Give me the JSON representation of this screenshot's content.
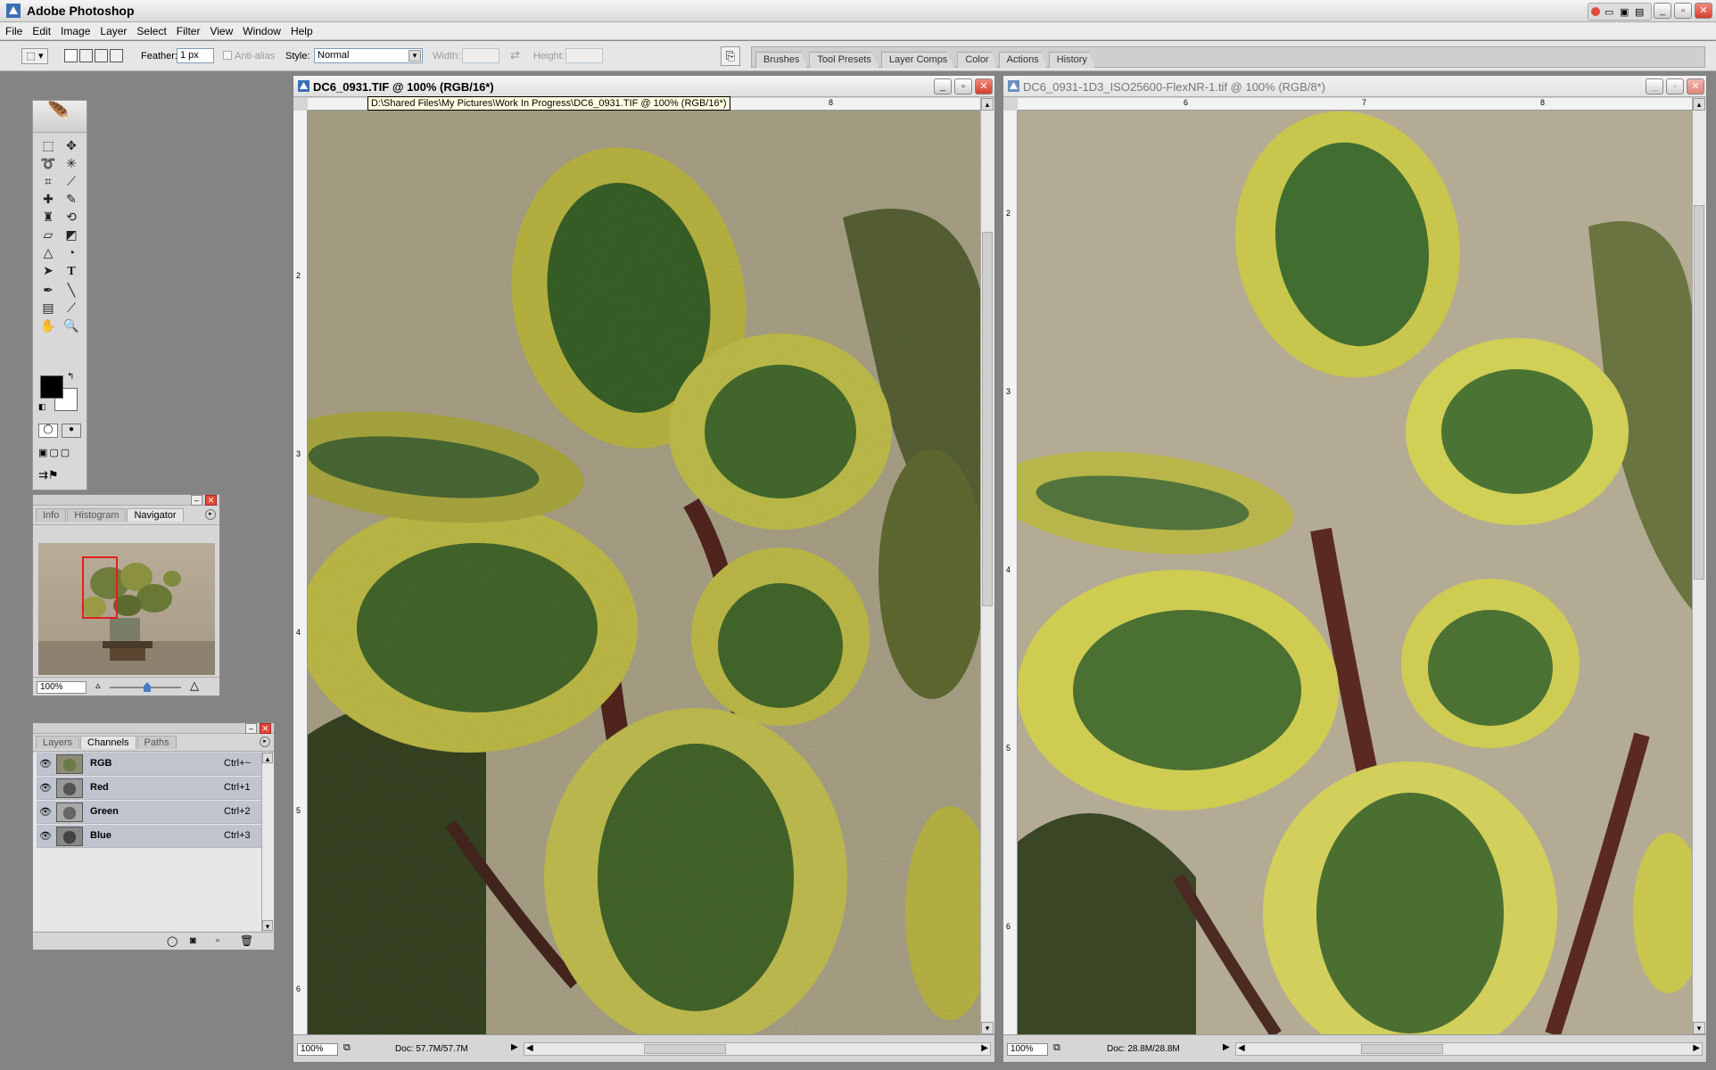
{
  "app": {
    "title": "Adobe Photoshop"
  },
  "menu": [
    "File",
    "Edit",
    "Image",
    "Layer",
    "Select",
    "Filter",
    "View",
    "Window",
    "Help"
  ],
  "options": {
    "feather_label": "Feather:",
    "feather_value": "1 px",
    "antialias_label": "Anti-alias",
    "style_label": "Style:",
    "style_value": "Normal",
    "width_label": "Width:",
    "height_label": "Height:"
  },
  "palette_well": [
    "Brushes",
    "Tool Presets",
    "Layer Comps",
    "Color",
    "Actions",
    "History"
  ],
  "navigator": {
    "tabs": [
      "Info",
      "Histogram",
      "Navigator"
    ],
    "zoom": "100%"
  },
  "channels": {
    "tabs": [
      "Layers",
      "Channels",
      "Paths"
    ],
    "rows": [
      {
        "name": "RGB",
        "key": "Ctrl+~"
      },
      {
        "name": "Red",
        "key": "Ctrl+1"
      },
      {
        "name": "Green",
        "key": "Ctrl+2"
      },
      {
        "name": "Blue",
        "key": "Ctrl+3"
      }
    ]
  },
  "doc1": {
    "title": "DC6_0931.TIF @ 100% (RGB/16*)",
    "tooltip": "D:\\Shared Files\\My Pictures\\Work In Progress\\DC6_0931.TIF @ 100% (RGB/16*)",
    "zoom": "100%",
    "doc_size": "Doc: 57.7M/57.7M",
    "ruler_top": [
      "8"
    ],
    "ruler_left": [
      "2",
      "3",
      "4",
      "5",
      "6"
    ]
  },
  "doc2": {
    "title": "DC6_0931-1D3_ISO25600-FlexNR-1.tif @ 100% (RGB/8*)",
    "zoom": "100%",
    "doc_size": "Doc: 28.8M/28.8M",
    "ruler_top": [
      "6",
      "7",
      "8"
    ],
    "ruler_left": [
      "2",
      "3",
      "4",
      "5",
      "6"
    ]
  },
  "colors": {
    "accent": "#e04a3a",
    "workspace": "#848484"
  }
}
